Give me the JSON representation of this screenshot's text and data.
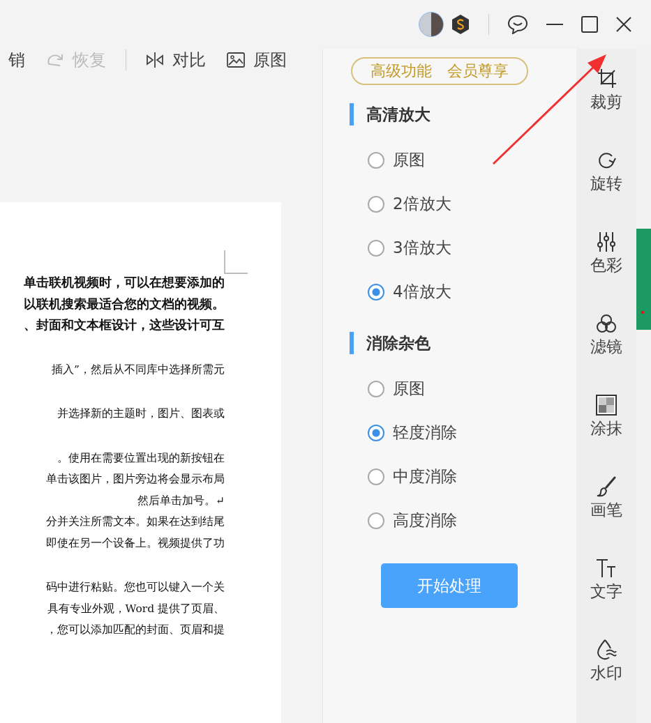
{
  "toolbar": [
    {
      "kind": "undo",
      "label": "销",
      "disabled": false
    },
    {
      "kind": "redo",
      "label": "恢复",
      "disabled": true
    },
    {
      "kind": "compare",
      "label": "对比",
      "disabled": false
    },
    {
      "kind": "original",
      "label": "原图",
      "disabled": false
    }
  ],
  "document": {
    "paragraphs": [
      {
        "bold": true,
        "lines": [
          "单击联机视频时，可以在想要添加的",
          "以联机搜索最适合您的文档的视频。",
          "、封面和文本框设计，这些设计可互"
        ]
      },
      {
        "bold": false,
        "lines": [
          "插入”，然后从不同库中选择所需元"
        ]
      },
      {
        "bold": false,
        "lines": [
          "并选择新的主题时，图片、图表或"
        ]
      },
      {
        "bold": false,
        "lines": [
          "。使用在需要位置出现的新按钮在",
          "单击该图片，图片旁边将会显示布局",
          "然后单击加号。↵",
          "分并关注所需文本。如果在达到结尾",
          "即使在另一个设备上。视频提供了功"
        ]
      },
      {
        "bold": false,
        "lines": [
          "码中进行粘贴。您也可以键入一个关",
          "具有专业外观，Word 提供了页眉、",
          "，您可以添加匹配的封面、页眉和提"
        ]
      }
    ]
  },
  "panel": {
    "premium": "高级功能　会员尊享",
    "groups": [
      {
        "title": "高清放大",
        "options": [
          {
            "label": "原图",
            "selected": false
          },
          {
            "label": "2倍放大",
            "selected": false
          },
          {
            "label": "3倍放大",
            "selected": false
          },
          {
            "label": "4倍放大",
            "selected": true
          }
        ]
      },
      {
        "title": "消除杂色",
        "options": [
          {
            "label": "原图",
            "selected": false
          },
          {
            "label": "轻度消除",
            "selected": true
          },
          {
            "label": "中度消除",
            "selected": false
          },
          {
            "label": "高度消除",
            "selected": false
          }
        ]
      }
    ],
    "start_button": "开始处理"
  },
  "tools": [
    {
      "kind": "crop",
      "label": "裁剪"
    },
    {
      "kind": "rotate",
      "label": "旋转"
    },
    {
      "kind": "color",
      "label": "色彩"
    },
    {
      "kind": "filter",
      "label": "滤镜"
    },
    {
      "kind": "smear",
      "label": "涂抹"
    },
    {
      "kind": "brush",
      "label": "画笔"
    },
    {
      "kind": "text",
      "label": "文字"
    },
    {
      "kind": "watermark",
      "label": "水印"
    }
  ]
}
